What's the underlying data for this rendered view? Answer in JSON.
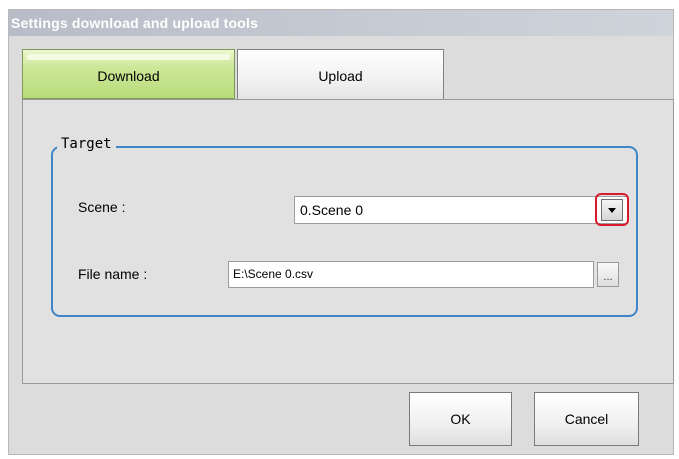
{
  "window": {
    "title": "Settings download and upload tools"
  },
  "tabs": [
    {
      "label": "Download",
      "active": true
    },
    {
      "label": "Upload",
      "active": false
    }
  ],
  "target_group": {
    "label": "Target",
    "scene": {
      "label": "Scene :",
      "value": "0.Scene 0"
    },
    "file_name": {
      "label": "File name :",
      "value": "E:\\Scene 0.csv",
      "browse_label": "..."
    }
  },
  "buttons": {
    "ok": "OK",
    "cancel": "Cancel"
  },
  "colors": {
    "active_tab": "#c6e48c",
    "group_border": "#3f86c8",
    "highlight": "#d81b2a"
  },
  "icons": {
    "dropdown": "chevron-down-icon"
  }
}
